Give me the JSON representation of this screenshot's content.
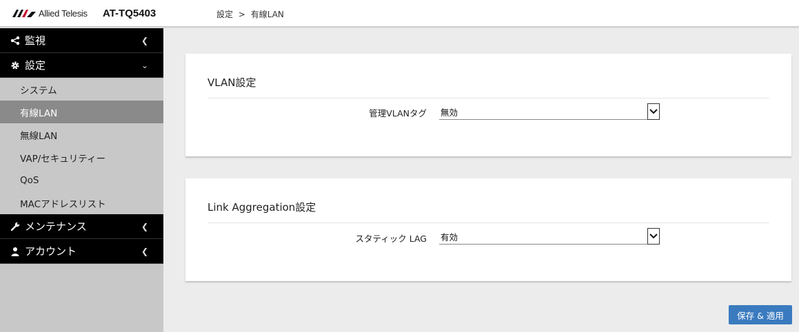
{
  "header": {
    "brand": "Allied Telesis",
    "model": "AT-TQ5403",
    "breadcrumb": [
      "設定",
      ">",
      "有線LAN"
    ]
  },
  "sidebar": {
    "monitor": {
      "label": "監視",
      "icon": "share-icon"
    },
    "settings": {
      "label": "設定",
      "icon": "gear-icon"
    },
    "sub_items": [
      "システム",
      "有線LAN",
      "無線LAN",
      "VAP/セキュリティー",
      "QoS",
      "MACアドレスリスト"
    ],
    "active_sub": "有線LAN",
    "maintenance": {
      "label": "メンテナンス",
      "icon": "wrench-icon"
    },
    "account": {
      "label": "アカウント",
      "icon": "user-icon"
    }
  },
  "vlan_panel": {
    "title": "VLAN設定",
    "field_label": "管理VLANタグ",
    "field_value": "無効"
  },
  "lag_panel": {
    "title": "Link Aggregation設定",
    "field_label": "スタティック LAG",
    "field_value": "有効"
  },
  "actions": {
    "save_label": "保存 & 適用"
  },
  "colors": {
    "sidebar_bg": "#c8c8c8",
    "nav_bg": "#000000",
    "active_item": "#8a8a8a",
    "button": "#3a7bbf",
    "brand": "#c8102e"
  }
}
